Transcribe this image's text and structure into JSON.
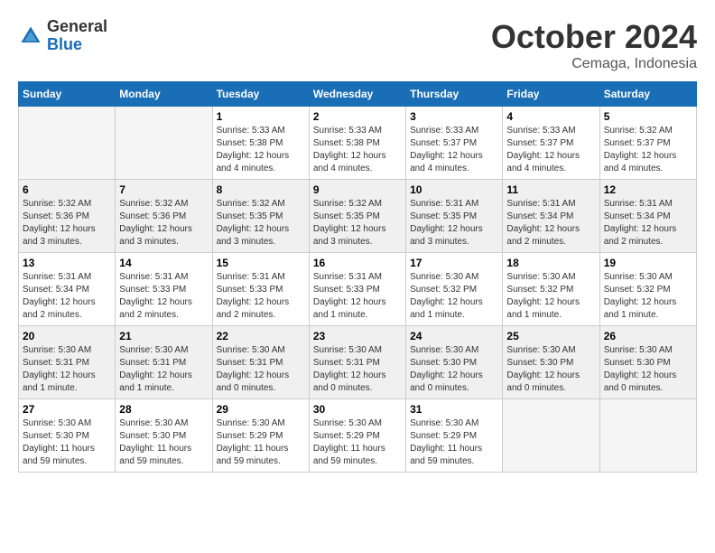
{
  "header": {
    "logo": {
      "general": "General",
      "blue": "Blue"
    },
    "month": "October 2024",
    "location": "Cemaga, Indonesia"
  },
  "weekdays": [
    "Sunday",
    "Monday",
    "Tuesday",
    "Wednesday",
    "Thursday",
    "Friday",
    "Saturday"
  ],
  "weeks": [
    [
      {
        "day": "",
        "info": ""
      },
      {
        "day": "",
        "info": ""
      },
      {
        "day": "1",
        "info": "Sunrise: 5:33 AM\nSunset: 5:38 PM\nDaylight: 12 hours and 4 minutes."
      },
      {
        "day": "2",
        "info": "Sunrise: 5:33 AM\nSunset: 5:38 PM\nDaylight: 12 hours and 4 minutes."
      },
      {
        "day": "3",
        "info": "Sunrise: 5:33 AM\nSunset: 5:37 PM\nDaylight: 12 hours and 4 minutes."
      },
      {
        "day": "4",
        "info": "Sunrise: 5:33 AM\nSunset: 5:37 PM\nDaylight: 12 hours and 4 minutes."
      },
      {
        "day": "5",
        "info": "Sunrise: 5:32 AM\nSunset: 5:37 PM\nDaylight: 12 hours and 4 minutes."
      }
    ],
    [
      {
        "day": "6",
        "info": "Sunrise: 5:32 AM\nSunset: 5:36 PM\nDaylight: 12 hours and 3 minutes."
      },
      {
        "day": "7",
        "info": "Sunrise: 5:32 AM\nSunset: 5:36 PM\nDaylight: 12 hours and 3 minutes."
      },
      {
        "day": "8",
        "info": "Sunrise: 5:32 AM\nSunset: 5:35 PM\nDaylight: 12 hours and 3 minutes."
      },
      {
        "day": "9",
        "info": "Sunrise: 5:32 AM\nSunset: 5:35 PM\nDaylight: 12 hours and 3 minutes."
      },
      {
        "day": "10",
        "info": "Sunrise: 5:31 AM\nSunset: 5:35 PM\nDaylight: 12 hours and 3 minutes."
      },
      {
        "day": "11",
        "info": "Sunrise: 5:31 AM\nSunset: 5:34 PM\nDaylight: 12 hours and 2 minutes."
      },
      {
        "day": "12",
        "info": "Sunrise: 5:31 AM\nSunset: 5:34 PM\nDaylight: 12 hours and 2 minutes."
      }
    ],
    [
      {
        "day": "13",
        "info": "Sunrise: 5:31 AM\nSunset: 5:34 PM\nDaylight: 12 hours and 2 minutes."
      },
      {
        "day": "14",
        "info": "Sunrise: 5:31 AM\nSunset: 5:33 PM\nDaylight: 12 hours and 2 minutes."
      },
      {
        "day": "15",
        "info": "Sunrise: 5:31 AM\nSunset: 5:33 PM\nDaylight: 12 hours and 2 minutes."
      },
      {
        "day": "16",
        "info": "Sunrise: 5:31 AM\nSunset: 5:33 PM\nDaylight: 12 hours and 1 minute."
      },
      {
        "day": "17",
        "info": "Sunrise: 5:30 AM\nSunset: 5:32 PM\nDaylight: 12 hours and 1 minute."
      },
      {
        "day": "18",
        "info": "Sunrise: 5:30 AM\nSunset: 5:32 PM\nDaylight: 12 hours and 1 minute."
      },
      {
        "day": "19",
        "info": "Sunrise: 5:30 AM\nSunset: 5:32 PM\nDaylight: 12 hours and 1 minute."
      }
    ],
    [
      {
        "day": "20",
        "info": "Sunrise: 5:30 AM\nSunset: 5:31 PM\nDaylight: 12 hours and 1 minute."
      },
      {
        "day": "21",
        "info": "Sunrise: 5:30 AM\nSunset: 5:31 PM\nDaylight: 12 hours and 1 minute."
      },
      {
        "day": "22",
        "info": "Sunrise: 5:30 AM\nSunset: 5:31 PM\nDaylight: 12 hours and 0 minutes."
      },
      {
        "day": "23",
        "info": "Sunrise: 5:30 AM\nSunset: 5:31 PM\nDaylight: 12 hours and 0 minutes."
      },
      {
        "day": "24",
        "info": "Sunrise: 5:30 AM\nSunset: 5:30 PM\nDaylight: 12 hours and 0 minutes."
      },
      {
        "day": "25",
        "info": "Sunrise: 5:30 AM\nSunset: 5:30 PM\nDaylight: 12 hours and 0 minutes."
      },
      {
        "day": "26",
        "info": "Sunrise: 5:30 AM\nSunset: 5:30 PM\nDaylight: 12 hours and 0 minutes."
      }
    ],
    [
      {
        "day": "27",
        "info": "Sunrise: 5:30 AM\nSunset: 5:30 PM\nDaylight: 11 hours and 59 minutes."
      },
      {
        "day": "28",
        "info": "Sunrise: 5:30 AM\nSunset: 5:30 PM\nDaylight: 11 hours and 59 minutes."
      },
      {
        "day": "29",
        "info": "Sunrise: 5:30 AM\nSunset: 5:29 PM\nDaylight: 11 hours and 59 minutes."
      },
      {
        "day": "30",
        "info": "Sunrise: 5:30 AM\nSunset: 5:29 PM\nDaylight: 11 hours and 59 minutes."
      },
      {
        "day": "31",
        "info": "Sunrise: 5:30 AM\nSunset: 5:29 PM\nDaylight: 11 hours and 59 minutes."
      },
      {
        "day": "",
        "info": ""
      },
      {
        "day": "",
        "info": ""
      }
    ]
  ]
}
